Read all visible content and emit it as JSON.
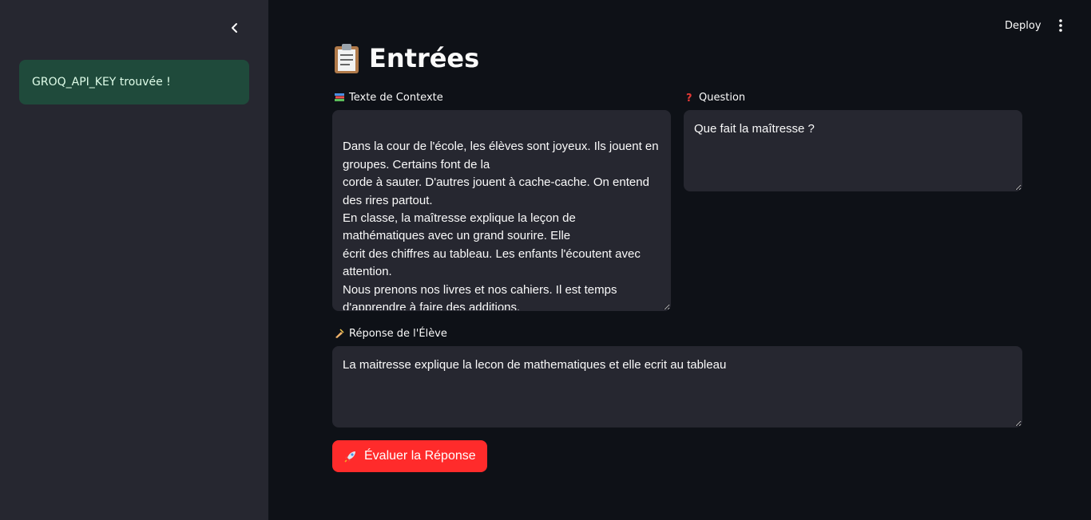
{
  "sidebar": {
    "collapse_icon": "chevron-left-icon",
    "alert_text": "GROQ_API_KEY trouvée !",
    "alert_color": "#1f4a3b"
  },
  "header": {
    "deploy_label": "Deploy",
    "menu_icon": "kebab-menu-icon"
  },
  "main": {
    "title": "Entrées",
    "title_icon": "clipboard-icon",
    "context": {
      "label": "Texte de Contexte",
      "icon": "books-icon",
      "value": "\nDans la cour de l'école, les élèves sont joyeux. Ils jouent en groupes. Certains font de la\ncorde à sauter. D'autres jouent à cache-cache. On entend des rires partout.\nEn classe, la maîtresse explique la leçon de mathématiques avec un grand sourire. Elle\nécrit des chiffres au tableau. Les enfants l'écoutent avec attention.\nNous prenons nos livres et nos cahiers. Il est temps d'apprendre à faire des additions."
    },
    "question": {
      "label": "Question",
      "icon": "question-mark-icon",
      "value": "Que fait la maîtresse ?"
    },
    "answer": {
      "label": "Réponse de l'Élève",
      "icon": "writing-hand-icon",
      "value": "La maitresse explique la lecon de mathematiques et elle ecrit au tableau"
    },
    "submit": {
      "label": "Évaluer la Réponse",
      "icon": "rocket-icon",
      "color": "#ff2b2b"
    }
  }
}
